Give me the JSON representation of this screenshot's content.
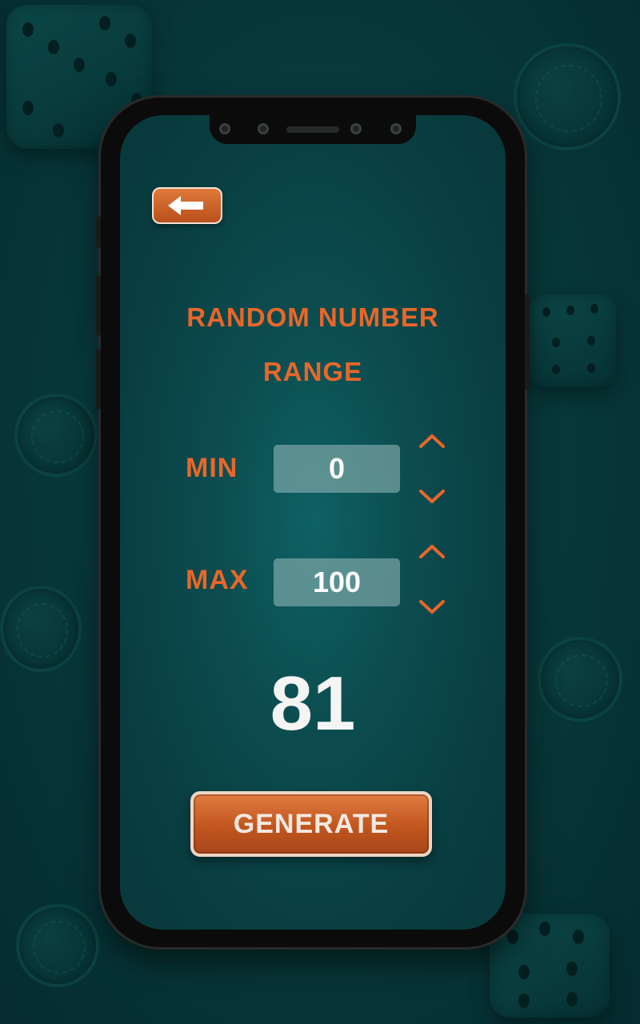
{
  "screen": {
    "title_line1": "RANDOM NUMBER",
    "title_line2": "RANGE"
  },
  "range": {
    "min_label": "MIN",
    "min_value": "0",
    "max_label": "MAX",
    "max_value": "100"
  },
  "result": {
    "value": "81"
  },
  "actions": {
    "generate_label": "GENERATE"
  },
  "colors": {
    "accent": "#e8672a",
    "background": "#083a3c",
    "value_box": "#8cb2b2"
  },
  "icons": {
    "back": "arrow-left-icon",
    "increment": "chevron-up-icon",
    "decrement": "chevron-down-icon"
  }
}
